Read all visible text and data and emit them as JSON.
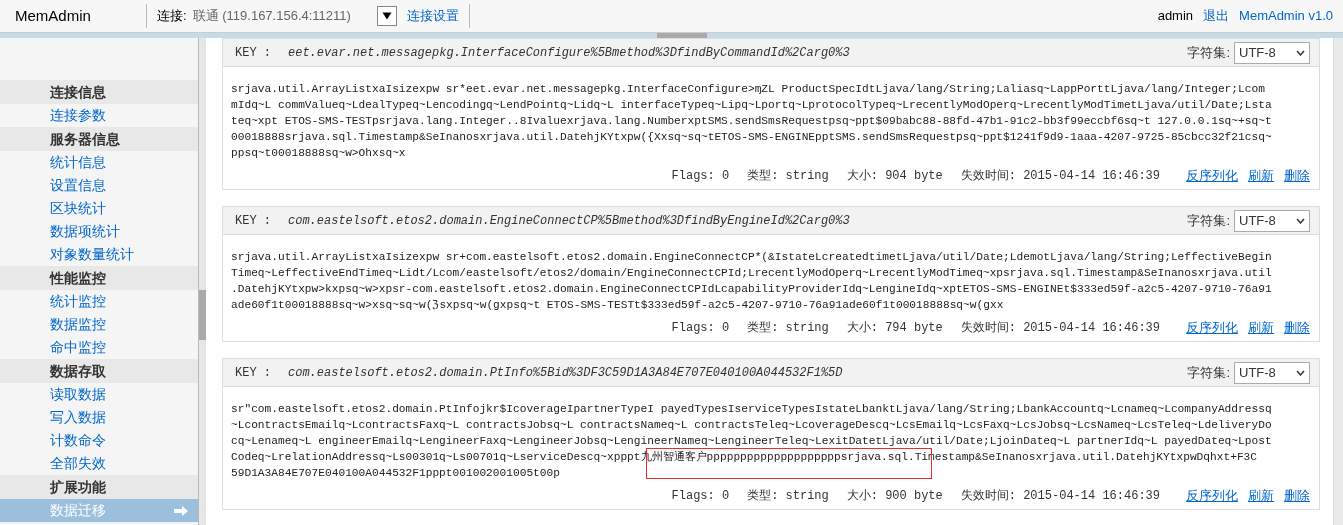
{
  "header": {
    "app_name": "MemAdmin",
    "connection_label": "连接:",
    "connection_value": "联通 (119.167.156.4:11211)",
    "connection_settings": "连接设置",
    "user": "admin",
    "logout": "退出",
    "version": "MemAdmin v1.0"
  },
  "sidebar": {
    "sections": [
      {
        "title": "连接信息",
        "items": [
          {
            "label": "连接参数",
            "selected": false
          }
        ]
      },
      {
        "title": "服务器信息",
        "items": [
          {
            "label": "统计信息",
            "selected": false
          },
          {
            "label": "设置信息",
            "selected": false
          },
          {
            "label": "区块统计",
            "selected": false
          },
          {
            "label": "数据项统计",
            "selected": false
          },
          {
            "label": "对象数量统计",
            "selected": false
          }
        ]
      },
      {
        "title": "性能监控",
        "items": [
          {
            "label": "统计监控",
            "selected": false
          },
          {
            "label": "数据监控",
            "selected": false
          },
          {
            "label": "命中监控",
            "selected": false
          }
        ]
      },
      {
        "title": "数据存取",
        "items": [
          {
            "label": "读取数据",
            "selected": false
          },
          {
            "label": "写入数据",
            "selected": false
          },
          {
            "label": "计数命令",
            "selected": false
          },
          {
            "label": "全部失效",
            "selected": false
          }
        ]
      },
      {
        "title": "扩展功能",
        "items": [
          {
            "label": "数据迁移",
            "selected": true
          }
        ]
      }
    ]
  },
  "entries": [
    {
      "key_label": "KEY :",
      "key": "eet.evar.net.messagepkg.InterfaceConfigure%5Bmethod%3DfindByCommandId%2Carg0%3",
      "charset_label": "字符集:",
      "charset": "UTF-8",
      "highlighted": false,
      "value_lines": [
        "srjava.util.ArrayListxaIsizexpw sr*eet.evar.net.messagepkg.InterfaceConfigure>ɱZL ProductSpecIdtLjava/lang/String;Laliasq~LappPorttLjava/lang/Integer;Lcom",
        "mIdq~L commValueq~LdealTypeq~Lencodingq~LendPointq~Lidq~L interfaceTypeq~Lipq~Lportq~LprotocolTypeq~LrecentlyModOperq~LrecentlyModTimetLjava/util/Date;Lsta",
        "teq~xpt ETOS-SMS-TESTpsrjava.lang.Integer..8Ivaluexrjava.lang.NumberxptSMS.sendSmsRequestpsq~ppt$09babc88-88fd-47b1-91c2-bb3f99eccbf6sq~t 127.0.0.1sq~+sq~t",
        "00018888srjava.sql.Timestamp&SeInanosxrjava.util.DatehjKYtxpw({Xxsq~sq~tETOS-SMS-ENGINEpptSMS.sendSmsRequestpsq~ppt$1241f9d9-1aaa-4207-9725-85cbcc32f21csq~",
        "ppsq~t00018888sq~w>Ohxsq~x"
      ],
      "flags": "Flags: 0",
      "type": "类型: string",
      "size": "大小: 904 byte",
      "expires": "失效时间: 2015-04-14 16:46:39",
      "actions": [
        "反序列化",
        "刷新",
        "删除"
      ]
    },
    {
      "key_label": "KEY :",
      "key": "com.eastelsoft.etos2.domain.EngineConnectCP%5Bmethod%3DfindByEngineId%2Carg0%3",
      "charset_label": "字符集:",
      "charset": "UTF-8",
      "highlighted": false,
      "value_lines": [
        "srjava.util.ArrayListxaIsizexpw sr+com.eastelsoft.etos2.domain.EngineConnectCP*(&IstateLcreatedtimetLjava/util/Date;LdemotLjava/lang/String;LeffectiveBegin",
        "Timeq~LeffectiveEndTimeq~Lidt/Lcom/eastelsoft/etos2/domain/EngineConnectCPId;LrecentlyModOperq~LrecentlyModTimeq~xpsrjava.sql.Timestamp&SeInanosxrjava.util",
        ".DatehjKYtxpw>kxpsq~w>xpsr-com.eastelsoft.etos2.domain.EngineConnectCPIdLcapabilityProviderIdq~LengineIdq~xptETOS-SMS-ENGINEt$333ed59f-a2c5-4207-9710-76a91",
        "ade60f1t00018888sq~w>xsq~sq~w(ℨsxpsq~w(gxpsq~t ETOS-SMS-TESTt$333ed59f-a2c5-4207-9710-76a91ade60f1t00018888sq~w(gxx"
      ],
      "flags": "Flags: 0",
      "type": "类型: string",
      "size": "大小: 794 byte",
      "expires": "失效时间: 2015-04-14 16:46:39",
      "actions": [
        "反序列化",
        "刷新",
        "删除"
      ]
    },
    {
      "key_label": "KEY :",
      "key": "com.eastelsoft.etos2.domain.PtInfo%5Bid%3DF3C59D1A3A84E707E040100A044532F1%5D",
      "charset_label": "字符集:",
      "charset": "UTF-8",
      "highlighted": true,
      "value_lines": [
        "sr\"com.eastelsoft.etos2.domain.PtInfojkr$IcoverageIpartnerTypeI payedTypesIserviceTypesIstateLbanktLjava/lang/String;LbankAccountq~Lcnameq~LcompanyAddressq",
        "~LcontractsEmailq~LcontractsFaxq~L contractsJobsq~L contractsNameq~L contractsTeleq~LcoverageDescq~LcsEmailq~LcsFaxq~LcsJobsq~LcsNameq~LcsTeleq~LdeliveryDo",
        "cq~Lenameq~L engineerEmailq~LengineerFaxq~LengineerJobsq~LengineerNameq~LengineerTeleq~LexitDatetLjava/util/Date;LjoinDateq~L partnerIdq~L payedDateq~Lpost",
        "Codeq~LrelationAddressq~Ls00301q~Ls00701q~LserviceDescq~xpppt九州智通客户ppppppppppppppppppppsrjava.sql.Timestamp&SeInanosxrjava.util.DatehjKYtxpwDqhxt+F3C",
        "59D1A3A84E707E040100A044532F1pppt001002001005t00p"
      ],
      "flags": "Flags: 0",
      "type": "类型: string",
      "size": "大小: 900 byte",
      "expires": "失效时间: 2015-04-14 16:46:39",
      "actions": [
        "反序列化",
        "刷新",
        "删除"
      ]
    }
  ]
}
